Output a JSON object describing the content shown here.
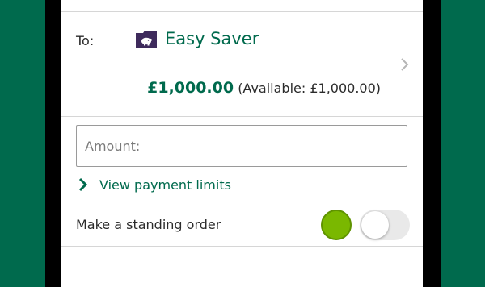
{
  "transfer": {
    "to_label": "To:",
    "account_name": "Easy Saver",
    "account_icon": "piggy-bank-icon",
    "balance": "£1,000.00",
    "available": "(Available: £1,000.00)"
  },
  "amount": {
    "placeholder": "Amount:",
    "value": ""
  },
  "limits": {
    "link_label": "View payment limits"
  },
  "standing_order": {
    "label": "Make a standing order",
    "enabled": false
  },
  "colors": {
    "brand_green": "#006a4d",
    "accent_lime": "#7ab800",
    "icon_purple": "#3e2a5c"
  }
}
